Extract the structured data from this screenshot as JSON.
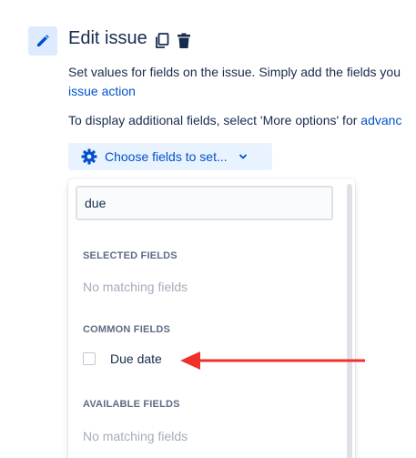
{
  "header": {
    "title": "Edit issue",
    "icon": "pencil-icon",
    "actions": [
      "copy-icon",
      "trash-icon"
    ]
  },
  "description": {
    "line1": "Set values for fields on the issue. Simply add the fields you",
    "line2_link": "issue action",
    "line3": "To display additional fields, select 'More options' for ",
    "line3_link": "advanc"
  },
  "choose_button": {
    "label": "Choose fields to set...",
    "icon": "gear-icon"
  },
  "dropdown": {
    "search_value": "due",
    "sections": {
      "selected": {
        "heading": "SELECTED FIELDS",
        "empty": "No matching fields"
      },
      "common": {
        "heading": "COMMON FIELDS",
        "options": [
          {
            "label": "Due date",
            "checked": false
          }
        ]
      },
      "available": {
        "heading": "AVAILABLE FIELDS",
        "empty": "No matching fields"
      }
    }
  },
  "colors": {
    "accent": "#0052cc",
    "arrow": "#f0302a"
  }
}
